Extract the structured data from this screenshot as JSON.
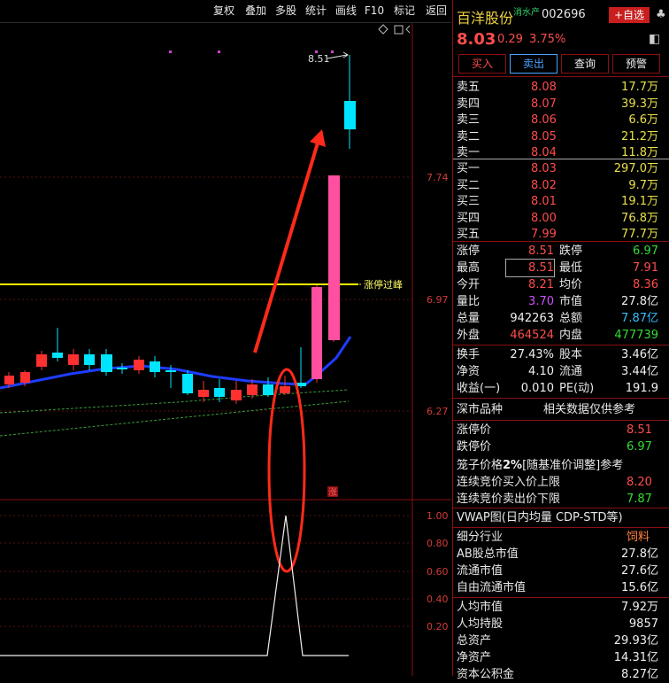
{
  "toolbar": {
    "items": [
      "复权",
      "叠加",
      "多股",
      "统计",
      "画线",
      "F10",
      "标记",
      "返回"
    ]
  },
  "chart": {
    "price_labels": [
      "7.74",
      "6.97",
      "6.27"
    ],
    "indicator_labels": [
      "1.00",
      "0.80",
      "0.60",
      "0.40",
      "0.20"
    ],
    "peak_label": "8.51",
    "limit_line_label": "涨停过峰",
    "zhang_badge": "涨",
    "icons": [
      "diamond-icon",
      "square-icon",
      "chevron-left-icon"
    ],
    "colors": {
      "up": "#ff3030",
      "down": "#00e5ff",
      "ma_blue": "#1e3cff",
      "limit_yellow": "#ffff00",
      "annot": "#ff2a1a"
    }
  },
  "stock": {
    "name": "百洋股份",
    "tag": "消水产",
    "code": "002696",
    "price": "8.03",
    "change": "0.29",
    "pct": "3.75%",
    "add_fav": "+自选"
  },
  "buttons": {
    "buy": "买入",
    "sell": "卖出",
    "query": "查询",
    "alert": "预警"
  },
  "asks": [
    {
      "label": "卖五",
      "price": "8.08",
      "vol": "17.7万"
    },
    {
      "label": "卖四",
      "price": "8.07",
      "vol": "39.3万"
    },
    {
      "label": "卖三",
      "price": "8.06",
      "vol": "6.6万"
    },
    {
      "label": "卖二",
      "price": "8.05",
      "vol": "21.2万"
    },
    {
      "label": "卖一",
      "price": "8.04",
      "vol": "11.8万"
    }
  ],
  "bids": [
    {
      "label": "买一",
      "price": "8.03",
      "vol": "297.0万"
    },
    {
      "label": "买二",
      "price": "8.02",
      "vol": "9.7万"
    },
    {
      "label": "买三",
      "price": "8.01",
      "vol": "19.1万"
    },
    {
      "label": "买四",
      "price": "8.00",
      "vol": "76.8万"
    },
    {
      "label": "买五",
      "price": "7.99",
      "vol": "77.7万"
    }
  ],
  "stats1": [
    {
      "l1": "涨停",
      "v1": "8.51",
      "l2": "跌停",
      "v2": "6.97"
    },
    {
      "l1": "最高",
      "v1": "8.51",
      "l2": "最低",
      "v2": "7.91"
    },
    {
      "l1": "今开",
      "v1": "8.21",
      "l2": "均价",
      "v2": "8.36"
    },
    {
      "l1": "量比",
      "v1": "3.70",
      "l2": "市值",
      "v2": "27.8亿"
    },
    {
      "l1": "总量",
      "v1": "942263",
      "l2": "总额",
      "v2": "7.87亿"
    },
    {
      "l1": "外盘",
      "v1": "464524",
      "l2": "内盘",
      "v2": "477739"
    }
  ],
  "stats2": [
    {
      "l1": "换手",
      "v1": "27.43%",
      "l2": "股本",
      "v2": "3.46亿"
    },
    {
      "l1": "净资",
      "v1": "4.10",
      "l2": "流通",
      "v2": "3.44亿"
    },
    {
      "l1": "收益(一)",
      "v1": "0.010",
      "l2": "PE(动)",
      "v2": "191.9"
    }
  ],
  "market": {
    "title": "深市品种",
    "note": "相关数据仅供参考"
  },
  "limits": [
    {
      "label": "涨停价",
      "value": "8.51"
    },
    {
      "label": "跌停价",
      "value": "6.97"
    }
  ],
  "cage": {
    "title_a": "笼子价格",
    "title_b": "2%",
    "title_c": "[随基准价调整]参考",
    "buy_label": "连续竞价买入价上限",
    "buy_value": "8.20",
    "sell_label": "连续竞价卖出价下限",
    "sell_value": "7.87"
  },
  "vwap": "VWAP图(日内均量 CDP-STD等)",
  "industry": {
    "label": "细分行业",
    "value": "饲料"
  },
  "caps": [
    {
      "label": "AB股总市值",
      "value": "27.8亿"
    },
    {
      "label": "流通市值",
      "value": "27.6亿"
    },
    {
      "label": "自由流通市值",
      "value": "15.6亿"
    }
  ],
  "percap": [
    {
      "label": "人均市值",
      "value": "7.92万"
    },
    {
      "label": "人均持股",
      "value": "9857"
    },
    {
      "label": "总资产",
      "value": "29.93亿"
    },
    {
      "label": "净资产",
      "value": "14.31亿"
    },
    {
      "label": "资本公积金",
      "value": "8.27亿"
    }
  ]
}
